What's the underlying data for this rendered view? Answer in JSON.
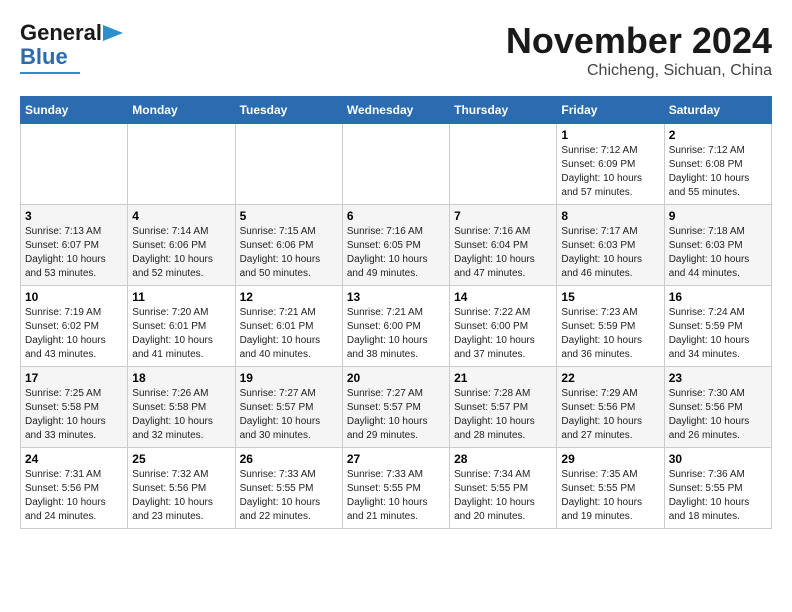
{
  "header": {
    "logo_line1": "General",
    "logo_line2": "Blue",
    "title": "November 2024",
    "subtitle": "Chicheng, Sichuan, China"
  },
  "calendar": {
    "weekdays": [
      "Sunday",
      "Monday",
      "Tuesday",
      "Wednesday",
      "Thursday",
      "Friday",
      "Saturday"
    ],
    "weeks": [
      [
        {
          "day": "",
          "info": ""
        },
        {
          "day": "",
          "info": ""
        },
        {
          "day": "",
          "info": ""
        },
        {
          "day": "",
          "info": ""
        },
        {
          "day": "",
          "info": ""
        },
        {
          "day": "1",
          "info": "Sunrise: 7:12 AM\nSunset: 6:09 PM\nDaylight: 10 hours and 57 minutes."
        },
        {
          "day": "2",
          "info": "Sunrise: 7:12 AM\nSunset: 6:08 PM\nDaylight: 10 hours and 55 minutes."
        }
      ],
      [
        {
          "day": "3",
          "info": "Sunrise: 7:13 AM\nSunset: 6:07 PM\nDaylight: 10 hours and 53 minutes."
        },
        {
          "day": "4",
          "info": "Sunrise: 7:14 AM\nSunset: 6:06 PM\nDaylight: 10 hours and 52 minutes."
        },
        {
          "day": "5",
          "info": "Sunrise: 7:15 AM\nSunset: 6:06 PM\nDaylight: 10 hours and 50 minutes."
        },
        {
          "day": "6",
          "info": "Sunrise: 7:16 AM\nSunset: 6:05 PM\nDaylight: 10 hours and 49 minutes."
        },
        {
          "day": "7",
          "info": "Sunrise: 7:16 AM\nSunset: 6:04 PM\nDaylight: 10 hours and 47 minutes."
        },
        {
          "day": "8",
          "info": "Sunrise: 7:17 AM\nSunset: 6:03 PM\nDaylight: 10 hours and 46 minutes."
        },
        {
          "day": "9",
          "info": "Sunrise: 7:18 AM\nSunset: 6:03 PM\nDaylight: 10 hours and 44 minutes."
        }
      ],
      [
        {
          "day": "10",
          "info": "Sunrise: 7:19 AM\nSunset: 6:02 PM\nDaylight: 10 hours and 43 minutes."
        },
        {
          "day": "11",
          "info": "Sunrise: 7:20 AM\nSunset: 6:01 PM\nDaylight: 10 hours and 41 minutes."
        },
        {
          "day": "12",
          "info": "Sunrise: 7:21 AM\nSunset: 6:01 PM\nDaylight: 10 hours and 40 minutes."
        },
        {
          "day": "13",
          "info": "Sunrise: 7:21 AM\nSunset: 6:00 PM\nDaylight: 10 hours and 38 minutes."
        },
        {
          "day": "14",
          "info": "Sunrise: 7:22 AM\nSunset: 6:00 PM\nDaylight: 10 hours and 37 minutes."
        },
        {
          "day": "15",
          "info": "Sunrise: 7:23 AM\nSunset: 5:59 PM\nDaylight: 10 hours and 36 minutes."
        },
        {
          "day": "16",
          "info": "Sunrise: 7:24 AM\nSunset: 5:59 PM\nDaylight: 10 hours and 34 minutes."
        }
      ],
      [
        {
          "day": "17",
          "info": "Sunrise: 7:25 AM\nSunset: 5:58 PM\nDaylight: 10 hours and 33 minutes."
        },
        {
          "day": "18",
          "info": "Sunrise: 7:26 AM\nSunset: 5:58 PM\nDaylight: 10 hours and 32 minutes."
        },
        {
          "day": "19",
          "info": "Sunrise: 7:27 AM\nSunset: 5:57 PM\nDaylight: 10 hours and 30 minutes."
        },
        {
          "day": "20",
          "info": "Sunrise: 7:27 AM\nSunset: 5:57 PM\nDaylight: 10 hours and 29 minutes."
        },
        {
          "day": "21",
          "info": "Sunrise: 7:28 AM\nSunset: 5:57 PM\nDaylight: 10 hours and 28 minutes."
        },
        {
          "day": "22",
          "info": "Sunrise: 7:29 AM\nSunset: 5:56 PM\nDaylight: 10 hours and 27 minutes."
        },
        {
          "day": "23",
          "info": "Sunrise: 7:30 AM\nSunset: 5:56 PM\nDaylight: 10 hours and 26 minutes."
        }
      ],
      [
        {
          "day": "24",
          "info": "Sunrise: 7:31 AM\nSunset: 5:56 PM\nDaylight: 10 hours and 24 minutes."
        },
        {
          "day": "25",
          "info": "Sunrise: 7:32 AM\nSunset: 5:56 PM\nDaylight: 10 hours and 23 minutes."
        },
        {
          "day": "26",
          "info": "Sunrise: 7:33 AM\nSunset: 5:55 PM\nDaylight: 10 hours and 22 minutes."
        },
        {
          "day": "27",
          "info": "Sunrise: 7:33 AM\nSunset: 5:55 PM\nDaylight: 10 hours and 21 minutes."
        },
        {
          "day": "28",
          "info": "Sunrise: 7:34 AM\nSunset: 5:55 PM\nDaylight: 10 hours and 20 minutes."
        },
        {
          "day": "29",
          "info": "Sunrise: 7:35 AM\nSunset: 5:55 PM\nDaylight: 10 hours and 19 minutes."
        },
        {
          "day": "30",
          "info": "Sunrise: 7:36 AM\nSunset: 5:55 PM\nDaylight: 10 hours and 18 minutes."
        }
      ]
    ]
  }
}
